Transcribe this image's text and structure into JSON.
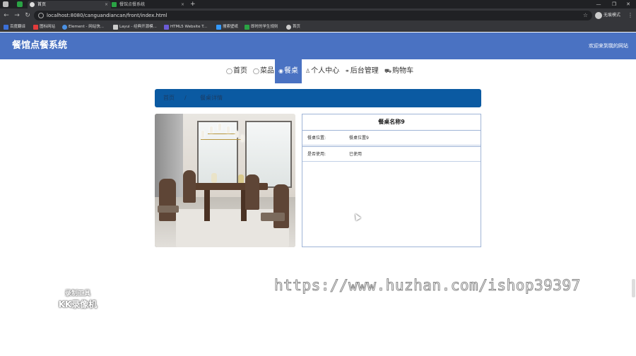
{
  "browser": {
    "tabs": [
      {
        "label": "首页",
        "active": true
      },
      {
        "label": "餐馆点餐系统",
        "active": false
      }
    ],
    "new_tab": "+",
    "url": "localhost:8080/canguandiancan/front/index.html",
    "profile_label": "无痕模式",
    "bookmarks": [
      "百度翻译",
      "图标网站",
      "Element - 网站快...",
      "Layui - 经典开源模...",
      "HTML5 Website T...",
      "搜索壁纸",
      "即时的学生规则",
      "首页"
    ],
    "colors": {
      "bookmark_icons": [
        "#3b6fd6",
        "#e23b3b",
        "#4a90e2",
        "#cccccc",
        "#6b5bd6",
        "#3399ff",
        "#2aa344",
        "#cccccc"
      ]
    }
  },
  "site": {
    "title": "餐馆点餐系统",
    "welcome": "欢迎来到我的网站",
    "nav": [
      {
        "label": "首页",
        "icon": "home-icon",
        "glyph": "◯"
      },
      {
        "label": "菜品",
        "icon": "dish-icon",
        "glyph": "◯"
      },
      {
        "label": "餐桌",
        "icon": "table-icon",
        "glyph": "◉",
        "active": true
      },
      {
        "label": "个人中心",
        "icon": "user-icon",
        "glyph": "♙"
      },
      {
        "label": "后台管理",
        "icon": "link-icon",
        "glyph": "⚭"
      },
      {
        "label": "购物车",
        "icon": "cart-icon",
        "glyph": "⛟"
      }
    ],
    "breadcrumb": [
      "首页",
      "/",
      "餐桌详情"
    ],
    "colors": {
      "header": "#4a72c2",
      "breadcrumb": "#0b5aa2",
      "border": "#9fb4d6"
    }
  },
  "detail": {
    "title": "餐桌名称9",
    "rows": [
      {
        "label": "餐桌位置:",
        "value": "餐桌位置9"
      },
      {
        "label": "是否使用:",
        "value": "已使用"
      }
    ]
  },
  "overlay": {
    "watermark": "https://www.huzhan.com/ishop39397",
    "rec_label_top": "录制工具",
    "rec_label_bottom": "KK录像机"
  }
}
